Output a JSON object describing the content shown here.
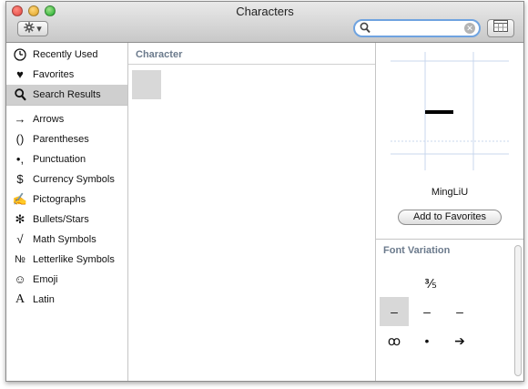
{
  "window": {
    "title": "Characters"
  },
  "toolbar": {
    "gear_label": "gear-icon",
    "gear_arrow": "▾"
  },
  "search": {
    "value": "",
    "placeholder": ""
  },
  "sidebar": {
    "items": [
      {
        "label": "Recently Used",
        "icon": "clock-icon",
        "glyph": ""
      },
      {
        "label": "Favorites",
        "icon": "heart-icon",
        "glyph": "♥"
      },
      {
        "label": "Search Results",
        "icon": "search-icon",
        "glyph": "",
        "selected": true
      },
      {
        "label": "Arrows",
        "icon": "arrow-icon",
        "glyph": "→"
      },
      {
        "label": "Parentheses",
        "icon": "parentheses-icon",
        "glyph": "()"
      },
      {
        "label": "Punctuation",
        "icon": "punctuation-icon",
        "glyph": "•,"
      },
      {
        "label": "Currency Symbols",
        "icon": "dollar-icon",
        "glyph": "$"
      },
      {
        "label": "Pictographs",
        "icon": "pictograph-icon",
        "glyph": "✍"
      },
      {
        "label": "Bullets/Stars",
        "icon": "asterisk-icon",
        "glyph": "✻"
      },
      {
        "label": "Math Symbols",
        "icon": "sqrt-icon",
        "glyph": "√"
      },
      {
        "label": "Letterlike Symbols",
        "icon": "numero-icon",
        "glyph": "№"
      },
      {
        "label": "Emoji",
        "icon": "smiley-icon",
        "glyph": "☺"
      },
      {
        "label": "Latin",
        "icon": "latin-a-icon",
        "glyph": "A"
      }
    ]
  },
  "character_column": {
    "header": "Character"
  },
  "detail": {
    "font_name": "MingLiU",
    "add_favorites_label": "Add to Favorites"
  },
  "font_variation": {
    "header": "Font Variation",
    "cells": [
      {
        "glyph": "⅗",
        "selected": false
      },
      {
        "glyph": "–",
        "selected": true
      },
      {
        "glyph": "–",
        "selected": false
      },
      {
        "glyph": "–",
        "selected": false
      },
      {
        "glyph": "ꝏ",
        "selected": false
      },
      {
        "glyph": "•",
        "selected": false
      },
      {
        "glyph": "➔",
        "selected": false
      }
    ]
  }
}
